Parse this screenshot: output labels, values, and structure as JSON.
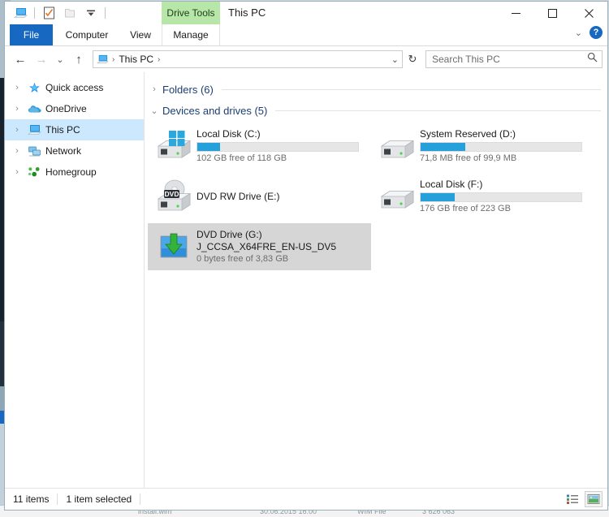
{
  "window": {
    "title": "This PC",
    "contextual_group": "Drive Tools",
    "controls": {
      "minimize": "—",
      "maximize": "☐",
      "close": "✕",
      "ribbon_collapse": "⌄",
      "help": "?"
    },
    "quick_access": [
      {
        "name": "this-pc-icon",
        "tooltip": "This PC"
      },
      {
        "name": "properties-icon",
        "tooltip": "Properties"
      },
      {
        "name": "new-folder-icon",
        "tooltip": "New folder"
      },
      {
        "name": "customize-dropdown-icon",
        "glyph": "⌄"
      }
    ]
  },
  "ribbon": {
    "tabs": [
      {
        "label": "File",
        "selected": true
      },
      {
        "label": "Computer",
        "selected": false
      },
      {
        "label": "View",
        "selected": false
      },
      {
        "label": "Manage",
        "selected": false
      }
    ]
  },
  "address": {
    "back_glyph": "←",
    "forward_glyph": "→",
    "recent_glyph": "⌄",
    "up_glyph": "↑",
    "breadcrumb_icon": "this-pc-icon",
    "crumbs": [
      "This PC"
    ],
    "separator": "›",
    "dropdown_glyph": "⌄",
    "refresh_glyph": "↻"
  },
  "search": {
    "placeholder": "Search This PC",
    "value": "",
    "icon": "search-icon"
  },
  "sidebar": {
    "items": [
      {
        "label": "Quick access",
        "icon": "star-icon",
        "selected": false,
        "chevron": "›"
      },
      {
        "label": "OneDrive",
        "icon": "cloud-icon",
        "selected": false,
        "chevron": "›"
      },
      {
        "label": "This PC",
        "icon": "this-pc-icon",
        "selected": true,
        "chevron": "›"
      },
      {
        "label": "Network",
        "icon": "network-icon",
        "selected": false,
        "chevron": "›"
      },
      {
        "label": "Homegroup",
        "icon": "homegroup-icon",
        "selected": false,
        "chevron": "›"
      }
    ]
  },
  "content": {
    "groups": [
      {
        "title": "Folders (6)",
        "expanded": false,
        "chevron": "›"
      },
      {
        "title": "Devices and drives (5)",
        "expanded": true,
        "chevron": "⌄"
      }
    ],
    "drives": [
      {
        "name": "Local Disk (C:)",
        "icon": "hard-drive-windows-icon",
        "free_text": "102 GB free of 118 GB",
        "used_percent": 14,
        "has_bar": true,
        "selected": false,
        "volume_label": ""
      },
      {
        "name": "System Reserved (D:)",
        "icon": "hard-drive-icon",
        "free_text": "71,8 MB free of 99,9 MB",
        "used_percent": 28,
        "has_bar": true,
        "selected": false,
        "volume_label": ""
      },
      {
        "name": "DVD RW Drive (E:)",
        "icon": "dvd-drive-icon",
        "free_text": "",
        "used_percent": 0,
        "has_bar": false,
        "selected": false,
        "volume_label": ""
      },
      {
        "name": "Local Disk (F:)",
        "icon": "hard-drive-icon",
        "free_text": "176 GB free of 223 GB",
        "used_percent": 21,
        "has_bar": true,
        "selected": false,
        "volume_label": ""
      },
      {
        "name": "DVD Drive (G:)",
        "icon": "disc-image-icon",
        "free_text": "0 bytes free of 3,83 GB",
        "used_percent": 100,
        "has_bar": false,
        "selected": true,
        "volume_label": "J_CCSA_X64FRE_EN-US_DV5"
      }
    ]
  },
  "status": {
    "item_count": "11 items",
    "selection": "1 item selected",
    "view_details_icon": "details-view-icon",
    "view_large_icons_icon": "large-icons-view-icon"
  },
  "background_window": {
    "file_name": "install.wim",
    "date": "30.06.2015 16:00",
    "type": "WIM File",
    "size": "3 626 063"
  },
  "colors": {
    "accent_blue": "#1668c1",
    "selection_blue": "#cce8ff",
    "capacity_blue": "#26a0da",
    "contextual_green": "#b6e7a8",
    "group_title": "#1b3e73",
    "tile_selected": "#d6d6d6"
  }
}
